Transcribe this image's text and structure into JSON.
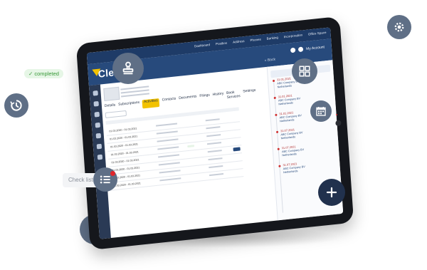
{
  "badge": {
    "text": "completed"
  },
  "icons": {
    "stamp": "stamp-icon",
    "grid": "grid-icon",
    "calendar": "calendar-icon",
    "settings": "gear-icon",
    "history": "history-icon",
    "checklist": "checklist-icon",
    "add_building": "add-building-icon",
    "plus": "plus-icon"
  },
  "colors": {
    "icon_button": "#5f6f86",
    "plus_button": "#21314d",
    "badge_bg": "#e6f6e6",
    "badge_text": "#3a9a3a",
    "app_header": "#274a7c",
    "accent": "#f2c200"
  },
  "tablet_app": {
    "brand": "Clevver",
    "top_menu": [
      "Dashboard",
      "Postbox",
      "Address",
      "Phones",
      "Banking",
      "Incorporation",
      "Office Space"
    ],
    "user_name": "My Account",
    "back_label": "« Back",
    "tabs": [
      "Details",
      "Subscriptions",
      "Activities",
      "Contacts",
      "Documents",
      "Filings",
      "History",
      "Book Services",
      "Settings"
    ],
    "active_tab": "Activities",
    "table_rows": [
      {
        "date": "01.03.2020 - 01.03.2021"
      },
      {
        "date": "01.03.2020 - 01.03.2021"
      },
      {
        "date": "01.03.2020 - 01.03.2021"
      },
      {
        "date": "01.03.2020 - 01.03.2021"
      },
      {
        "date": "01.03.2020 - 01.03.2021"
      },
      {
        "date": "01.03.2020 - 01.03.2021"
      },
      {
        "date": "01.03.2020 - 01.03.2021"
      },
      {
        "date": "01.03.2020 - 01.03.2021"
      }
    ],
    "timeline": [
      {
        "date": "31.01.2021",
        "line1": "ABC Company BV",
        "line2": "Netherlands"
      },
      {
        "date": "31.01.2021",
        "line1": "ABC Company BV",
        "line2": "Netherlands"
      },
      {
        "date": "31.01.2021",
        "line1": "ABC Company BV",
        "line2": "Netherlands"
      },
      {
        "date": "31.07.2021",
        "line1": "ABC Company BV",
        "line2": "Netherlands"
      },
      {
        "date": "31.07.2021",
        "line1": "ABC Company BV",
        "line2": "Netherlands"
      },
      {
        "date": "31.07.2021",
        "line1": "ABC Company BV",
        "line2": "Netherlands"
      }
    ]
  },
  "checklist_chip": {
    "text": "Check list"
  }
}
